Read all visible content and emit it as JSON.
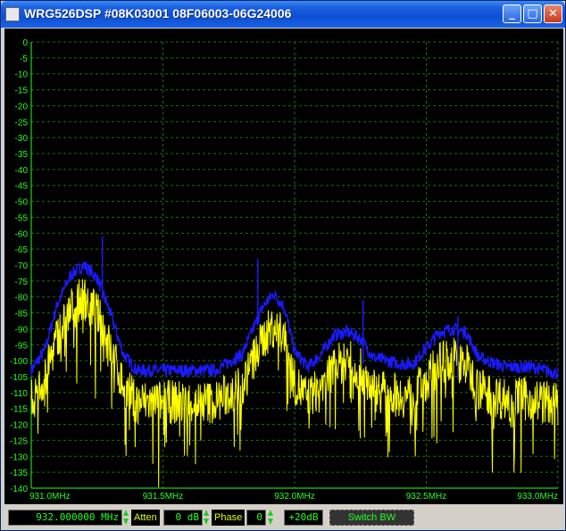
{
  "window": {
    "title": "WRG526DSP #08K03001 08F06003-06G24006"
  },
  "titlebar_buttons": {
    "minimize": "_",
    "maximize": "□",
    "close": "✕"
  },
  "controls": {
    "frequency_value": "932.000000 MHz",
    "atten_label": "Atten",
    "atten_value": "0 dB",
    "phase_label": "Phase",
    "phase_value": "0",
    "gain_value": "+20dB",
    "switch_bw_label": "Switch BW"
  },
  "colors": {
    "background": "#000000",
    "grid": "#1f6b1f",
    "axis": "#22ff22",
    "max_hold": "#1a1aff",
    "live": "#ffff00"
  },
  "chart_data": {
    "type": "line",
    "xlim": [
      931.0,
      933.0
    ],
    "ylim": [
      -140,
      0
    ],
    "x_ticks": [
      {
        "value": 931.0,
        "label": "931.0MHz"
      },
      {
        "value": 931.5,
        "label": "931.5MHz"
      },
      {
        "value": 932.0,
        "label": "932.0MHz"
      },
      {
        "value": 932.5,
        "label": "932.5MHz"
      },
      {
        "value": 933.0,
        "label": "933.0MHz"
      }
    ],
    "y_ticks": [
      0,
      -5,
      -10,
      -15,
      -20,
      -25,
      -30,
      -35,
      -40,
      -45,
      -50,
      -55,
      -60,
      -65,
      -70,
      -75,
      -80,
      -85,
      -90,
      -95,
      -100,
      -105,
      -110,
      -115,
      -120,
      -125,
      -130,
      -135,
      -140
    ],
    "grid": true,
    "series": [
      {
        "role": "max-hold",
        "color": "#1a1aff",
        "x": [
          931.0,
          931.05,
          931.1,
          931.15,
          931.2,
          931.25,
          931.3,
          931.35,
          931.4,
          931.5,
          931.6,
          931.7,
          931.8,
          931.88,
          931.92,
          931.96,
          932.0,
          932.05,
          932.1,
          932.15,
          932.2,
          932.25,
          932.3,
          932.4,
          932.45,
          932.5,
          932.55,
          932.6,
          932.65,
          932.7,
          932.8,
          932.9,
          933.0
        ],
        "values": [
          -103,
          -97,
          -82,
          -73,
          -70,
          -74,
          -85,
          -98,
          -103,
          -103,
          -103,
          -103,
          -98,
          -83,
          -79,
          -83,
          -97,
          -102,
          -98,
          -92,
          -91,
          -93,
          -99,
          -101,
          -101,
          -96,
          -91,
          -90,
          -91,
          -99,
          -102,
          -102,
          -104
        ]
      },
      {
        "role": "live",
        "color": "#ffff00",
        "x": [
          931.0,
          931.05,
          931.1,
          931.15,
          931.2,
          931.25,
          931.3,
          931.35,
          931.4,
          931.5,
          931.6,
          931.7,
          931.8,
          931.88,
          931.92,
          931.96,
          932.0,
          932.05,
          932.1,
          932.15,
          932.2,
          932.25,
          932.3,
          932.4,
          932.45,
          932.5,
          932.55,
          932.6,
          932.65,
          932.7,
          932.8,
          932.9,
          933.0
        ],
        "values": [
          -113,
          -106,
          -92,
          -84,
          -80,
          -85,
          -96,
          -108,
          -113,
          -113,
          -113,
          -113,
          -108,
          -93,
          -89,
          -93,
          -107,
          -112,
          -108,
          -102,
          -100,
          -103,
          -109,
          -111,
          -111,
          -106,
          -101,
          -99,
          -101,
          -109,
          -112,
          -112,
          -114
        ]
      }
    ],
    "spikes": [
      {
        "x": 931.27,
        "value": -61
      },
      {
        "x": 931.86,
        "value": -68
      },
      {
        "x": 932.26,
        "value": -81
      },
      {
        "x": 932.62,
        "value": -86
      }
    ]
  }
}
